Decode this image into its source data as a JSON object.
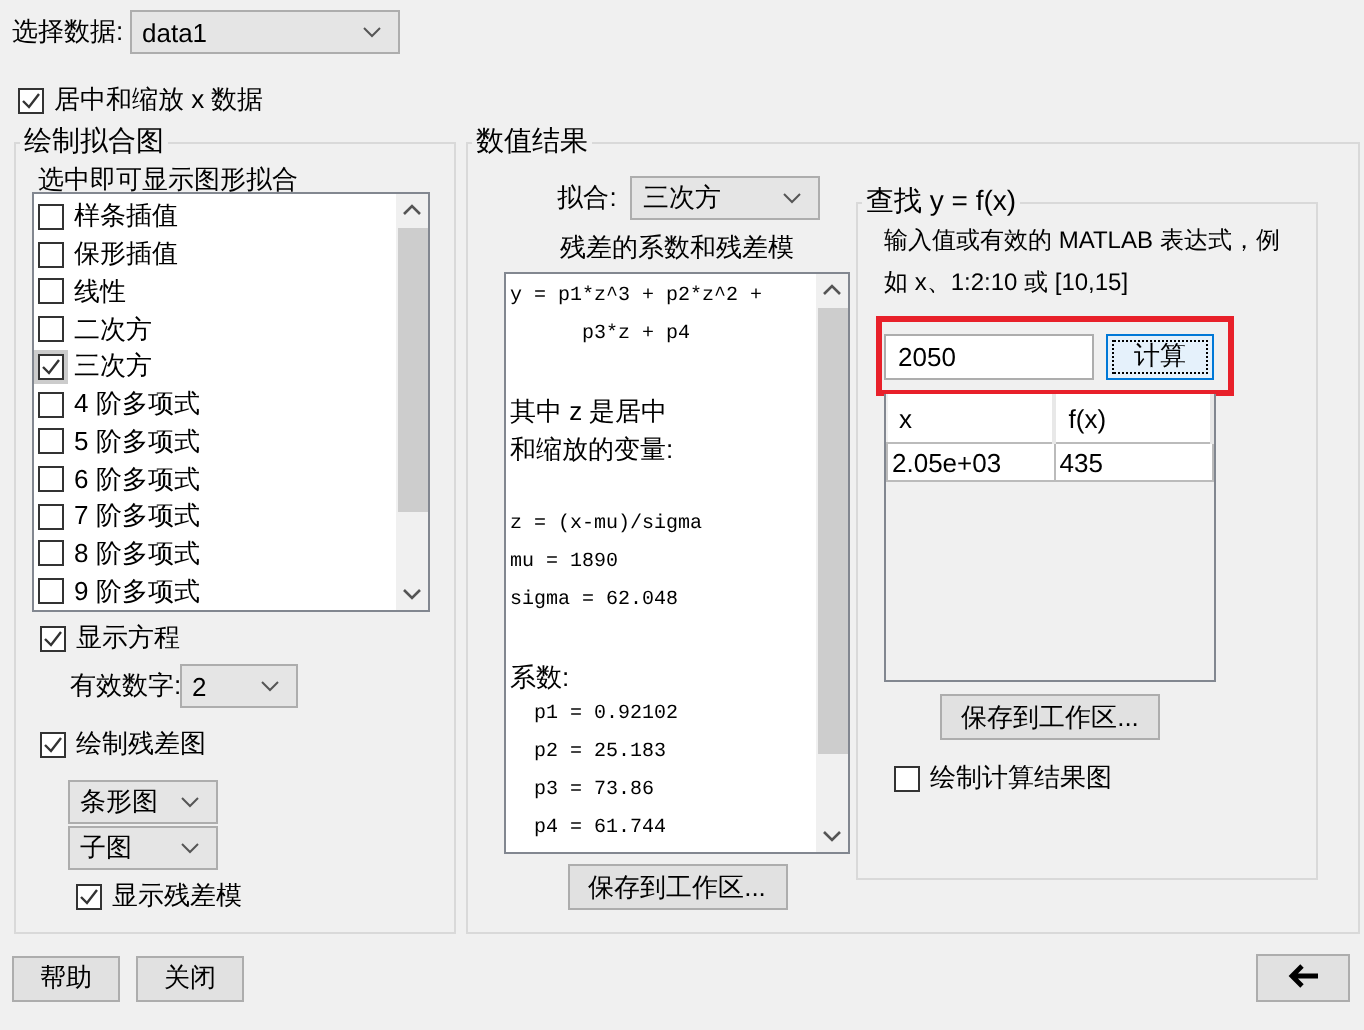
{
  "data_select": {
    "label": "选择数据:",
    "value": "data1"
  },
  "center_scale": {
    "label": "居中和缩放 x 数据",
    "checked": true
  },
  "plot_fits": {
    "title": "绘制拟合图",
    "hint": "选中即可显示图形拟合",
    "fits": [
      {
        "label": "样条插值",
        "checked": false
      },
      {
        "label": "保形插值",
        "checked": false
      },
      {
        "label": "线性",
        "checked": false
      },
      {
        "label": "二次方",
        "checked": false
      },
      {
        "label": "三次方",
        "checked": true
      },
      {
        "label": "4 阶多项式",
        "checked": false
      },
      {
        "label": "5 阶多项式",
        "checked": false
      },
      {
        "label": "6 阶多项式",
        "checked": false
      },
      {
        "label": "7 阶多项式",
        "checked": false
      },
      {
        "label": "8 阶多项式",
        "checked": false
      },
      {
        "label": "9 阶多项式",
        "checked": false
      }
    ],
    "show_equation": {
      "label": "显示方程",
      "checked": true
    },
    "significant_digits": {
      "label": "有效数字:",
      "value": "2"
    },
    "plot_residuals": {
      "label": "绘制残差图",
      "checked": true
    },
    "residual_plot_type": {
      "value": "条形图"
    },
    "residual_plot_location": {
      "value": "子图"
    },
    "show_residual_norm": {
      "label": "显示残差模",
      "checked": true
    }
  },
  "numerical_results": {
    "title": "数值结果",
    "fit": {
      "label": "拟合:",
      "value": "三次方"
    },
    "coefficients_label": "残差的系数和残差模",
    "coefficients_text": [
      [
        {
          "kind": "code",
          "text": "y = p1*z^3 + p2*z^2 +"
        },
        {
          "kind": "code",
          "text": "      p3*z + p4"
        }
      ],
      [
        {
          "kind": "text",
          "text": "其中 z 是居中"
        },
        {
          "kind": "text",
          "text": "和缩放的变量:"
        }
      ],
      [
        {
          "kind": "code",
          "text": "z = (x-mu)/sigma"
        },
        {
          "kind": "code",
          "text": "mu = 1890"
        },
        {
          "kind": "code",
          "text": "sigma = 62.048"
        }
      ],
      [
        {
          "kind": "text",
          "text": "系数:"
        },
        {
          "kind": "code",
          "text": "  p1 = 0.92102"
        },
        {
          "kind": "code",
          "text": "  p2 = 25.183"
        },
        {
          "kind": "code",
          "text": "  p3 = 73.86"
        },
        {
          "kind": "code",
          "text": "  p4 = 61.744"
        }
      ]
    ],
    "save_button": "保存到工作区...",
    "find": {
      "title": "查找 y = f(x)",
      "help": "输入值或有效的 MATLAB 表达式，例如 x、1:2:10 或 [10,15]",
      "input": {
        "value": "2050"
      },
      "compute_button": "计算",
      "table": {
        "columns": [
          "x",
          "f(x)"
        ],
        "rows": [
          [
            "2.05e+03",
            "435"
          ]
        ]
      },
      "save_button": "保存到工作区...",
      "plot_results": {
        "label": "绘制计算结果图",
        "checked": false
      }
    }
  },
  "buttons": [
    {
      "label": "帮助"
    },
    {
      "label": "关闭"
    }
  ]
}
